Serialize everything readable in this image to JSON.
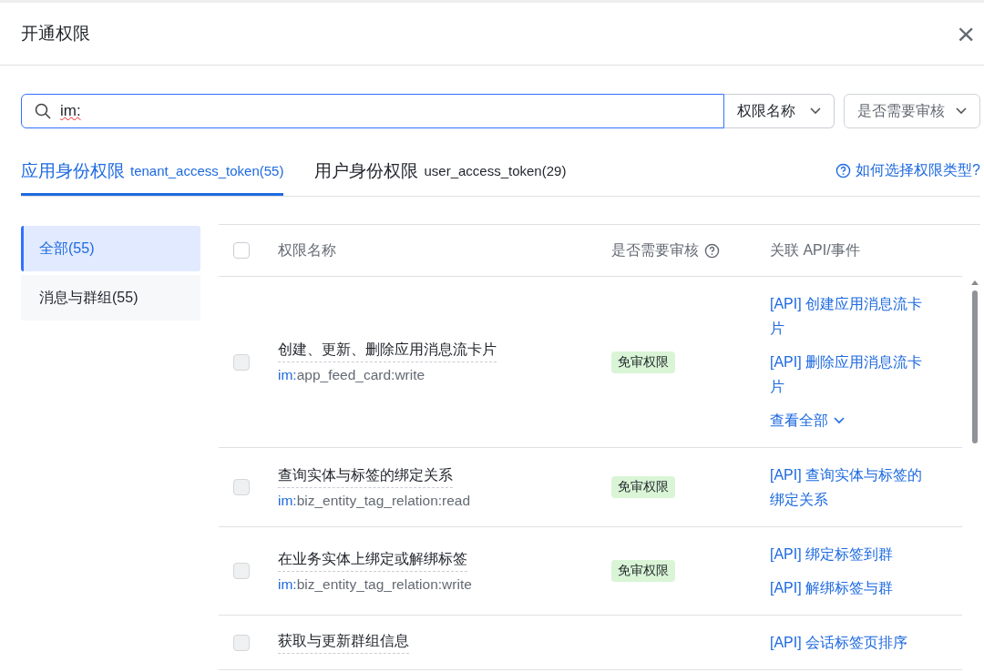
{
  "dialog": {
    "title": "开通权限",
    "close": "×"
  },
  "search": {
    "value": "im:",
    "filters": [
      {
        "label": "权限名称"
      },
      {
        "label": "是否需要审核"
      }
    ]
  },
  "tabs": [
    {
      "label": "应用身份权限",
      "token": "tenant_access_token(55)",
      "selected": true
    },
    {
      "label": "用户身份权限",
      "token": "user_access_token(29)",
      "selected": false
    }
  ],
  "help_link": "如何选择权限类型?",
  "sidebar": {
    "items": [
      {
        "label": "全部(55)",
        "selected": true
      },
      {
        "label": "消息与群组(55)",
        "selected": false
      }
    ]
  },
  "table": {
    "columns": [
      {
        "label": "权限名称",
        "help": false
      },
      {
        "label": "是否需要审核",
        "help": true
      },
      {
        "label": "关联 API/事件",
        "help": false
      }
    ],
    "header_checked": false,
    "rows": [
      {
        "checked": false,
        "disabled": true,
        "name": "创建、更新、删除应用消息流卡片",
        "match": "im:",
        "scope": "app_feed_card:write",
        "badge": "免审权限",
        "apis": [
          "[API] 创建应用消息流卡片",
          "[API] 删除应用消息流卡片"
        ],
        "more": "查看全部"
      },
      {
        "checked": false,
        "disabled": true,
        "name": "查询实体与标签的绑定关系",
        "match": "im:",
        "scope": "biz_entity_tag_relation:read",
        "badge": "免审权限",
        "apis": [
          "[API] 查询实体与标签的绑定关系"
        ]
      },
      {
        "checked": false,
        "disabled": true,
        "name": "在业务实体上绑定或解绑标签",
        "match": "im:",
        "scope": "biz_entity_tag_relation:write",
        "badge": "免审权限",
        "apis": [
          "[API] 绑定标签到群",
          "[API] 解绑标签与群"
        ]
      },
      {
        "checked": false,
        "disabled": true,
        "name": "获取与更新群组信息",
        "apis": [
          "[API] 会话标签页排序"
        ]
      }
    ]
  }
}
